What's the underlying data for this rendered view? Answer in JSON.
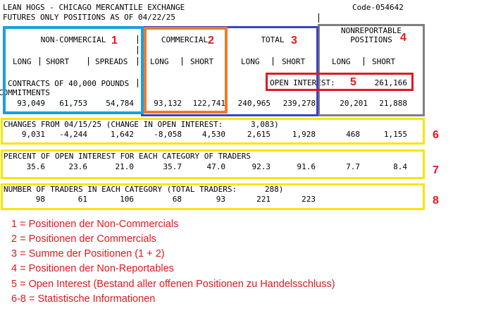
{
  "header": {
    "line1": "LEAN HOGS - CHICAGO MERCANTILE EXCHANGE",
    "code": "Code-054642",
    "line2": "FUTURES ONLY POSITIONS AS OF 04/22/25"
  },
  "categories": {
    "non_commercial": "NON-COMMERCIAL",
    "commercial": "COMMERCIAL",
    "total": "TOTAL",
    "nonreportable_line1": "NONREPORTABLE",
    "nonreportable_line2": "POSITIONS"
  },
  "columns": {
    "long": "LONG",
    "short": "SHORT",
    "spreads": "SPREADS"
  },
  "contracts_line1": "CONTRACTS OF 40,000 POUNDS",
  "contracts_line2": "COMMITMENTS",
  "open_interest": {
    "label": "OPEN INTEREST:",
    "value": "261,166"
  },
  "commitments": [
    "93,049",
    "61,753",
    "54,784",
    "93,132",
    "122,741",
    "240,965",
    "239,278",
    "20,201",
    "21,888"
  ],
  "changes": {
    "label": "CHANGES FROM 04/15/25 (CHANGE IN OPEN INTEREST:      3,083)",
    "values": [
      "9,031",
      "-4,244",
      "1,642",
      "-8,058",
      "4,530",
      "2,615",
      "1,928",
      "468",
      "1,155"
    ]
  },
  "percent": {
    "label": "PERCENT OF OPEN INTEREST FOR EACH CATEGORY OF TRADERS",
    "values": [
      "35.6",
      "23.6",
      "21.0",
      "35.7",
      "47.0",
      "92.3",
      "91.6",
      "7.7",
      "8.4"
    ]
  },
  "traders": {
    "label": "NUMBER OF TRADERS IN EACH CATEGORY (TOTAL TRADERS:      288)",
    "values": [
      "98",
      "61",
      "106",
      "68",
      "93",
      "221",
      "223"
    ]
  },
  "markers": [
    "1",
    "2",
    "3",
    "4",
    "5",
    "6",
    "7",
    "8"
  ],
  "legend": [
    "1 = Positionen der Non-Commercials",
    "2 = Positionen der Commercials",
    "3 = Summe der Positionen (1 + 2)",
    "4 = Positionen der Non-Reportables",
    "5 = Open Interest (Bestand aller offenen Positionen zu Handelsschluss)",
    "6-8 = Statistische Informationen"
  ],
  "colors": {
    "marker_red": "#e0191f",
    "box1": "#1a9fe0",
    "box2": "#f07a28",
    "box3": "#3a44c4",
    "box4": "#7f7f7f",
    "box5": "#e0191f",
    "boxes6_8": "#f6e600"
  }
}
